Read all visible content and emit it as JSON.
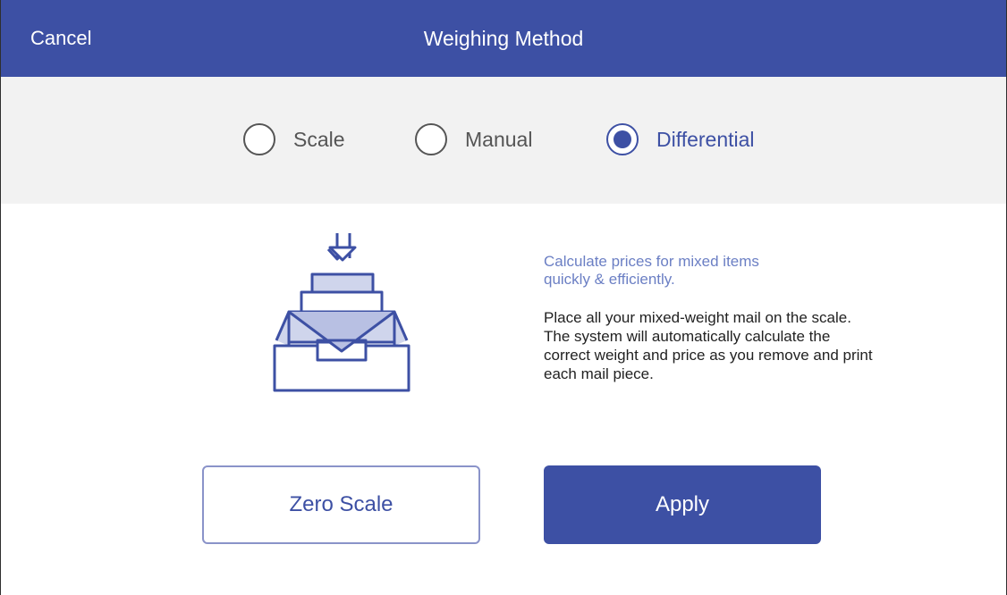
{
  "header": {
    "cancel_label": "Cancel",
    "title": "Weighing Method"
  },
  "weighing_options": [
    {
      "label": "Scale",
      "selected": false
    },
    {
      "label": "Manual",
      "selected": false
    },
    {
      "label": "Differential",
      "selected": true
    }
  ],
  "illustration": {
    "icon": "mail-tray-scale-icon"
  },
  "content": {
    "tagline_line1": "Calculate prices for mixed items",
    "tagline_line2": "quickly & efficiently.",
    "desc_line1": "Place all your mixed-weight mail on the scale.",
    "desc_line2": "The system will automatically calculate the",
    "desc_line3": "correct weight and price as you remove and print",
    "desc_line4": "each mail piece."
  },
  "actions": {
    "zero_scale_label": "Zero Scale",
    "apply_label": "Apply"
  },
  "colors": {
    "accent": "#3d50a4",
    "band": "#f2f2f2",
    "tagline": "#6b7fc4"
  }
}
